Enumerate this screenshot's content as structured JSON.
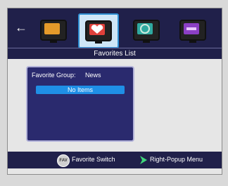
{
  "header": {
    "back_icon": "left-arrow-icon",
    "icons": [
      {
        "name": "all-channels-tv-icon",
        "screen_color": "#e59b2a",
        "selected": false
      },
      {
        "name": "favorites-heart-tv-icon",
        "screen_color": "#e0403a",
        "selected": true
      },
      {
        "name": "satellite-tv-icon",
        "screen_color": "#2fa9a0",
        "selected": false
      },
      {
        "name": "media-tv-icon",
        "screen_color": "#8b3fc4",
        "selected": false
      }
    ]
  },
  "title": "Favorites List",
  "panel": {
    "group_label": "Favorite Group:",
    "group_value": "News",
    "item": "No Items"
  },
  "footer": {
    "fav_icon_text": "FAV",
    "fav_label": "Favorite Switch",
    "right_label": "Right-Popup Menu",
    "accent": "#3fd67a"
  }
}
